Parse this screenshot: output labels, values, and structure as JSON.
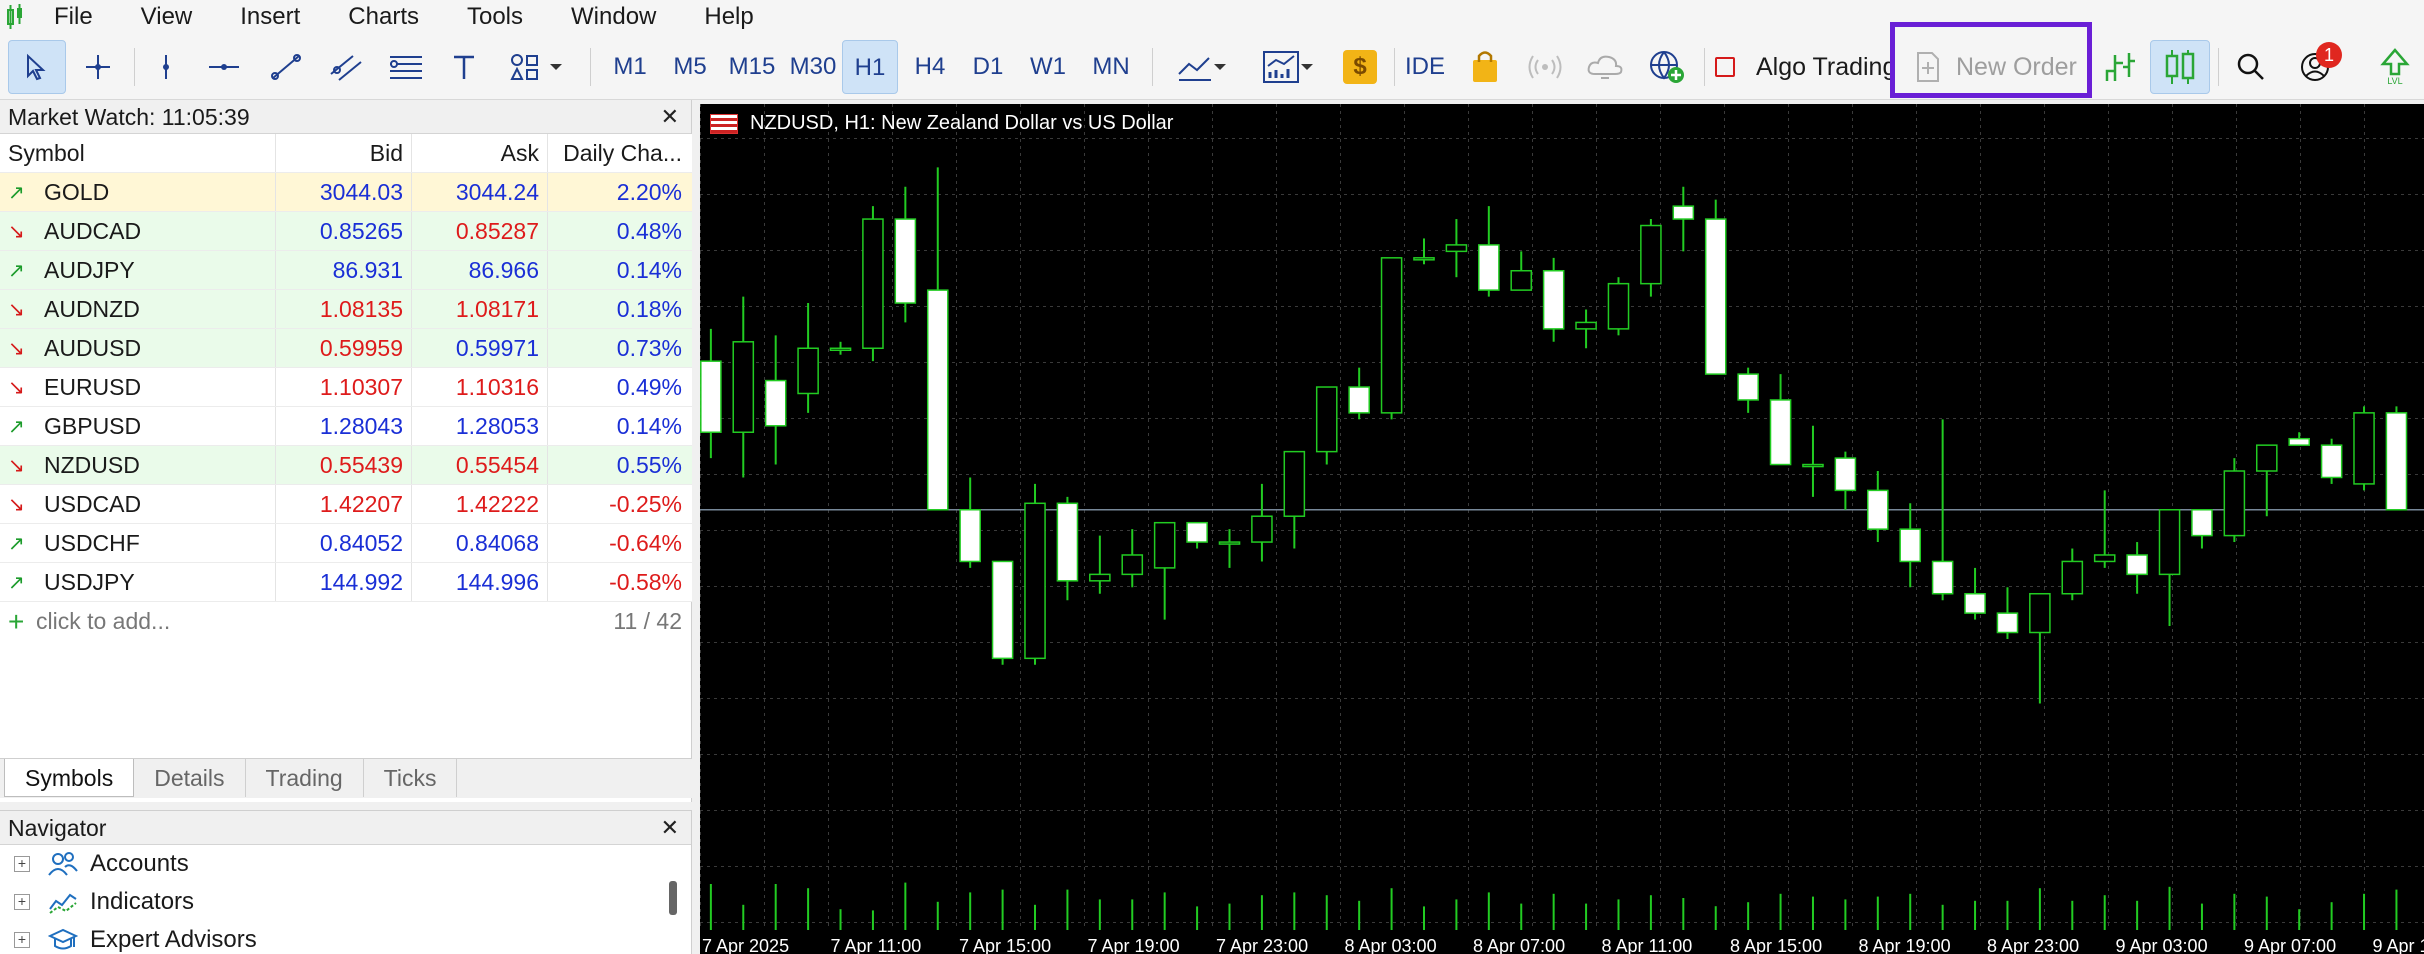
{
  "menu": [
    "File",
    "View",
    "Insert",
    "Charts",
    "Tools",
    "Window",
    "Help"
  ],
  "timeframes": [
    {
      "label": "M1",
      "active": false
    },
    {
      "label": "M5",
      "active": false
    },
    {
      "label": "M15",
      "active": false
    },
    {
      "label": "M30",
      "active": false
    },
    {
      "label": "H1",
      "active": true
    },
    {
      "label": "H4",
      "active": false
    },
    {
      "label": "D1",
      "active": false
    },
    {
      "label": "W1",
      "active": false
    },
    {
      "label": "MN",
      "active": false
    }
  ],
  "toolbar": {
    "ide_label": "IDE",
    "algo_trading_label": "Algo Trading",
    "new_order_label": "New Order",
    "notification_count": "1",
    "coin_symbol": "$"
  },
  "market_watch": {
    "title": "Market Watch: 11:05:39",
    "columns": [
      "Symbol",
      "Bid",
      "Ask",
      "Daily Cha..."
    ],
    "rows": [
      {
        "symbol": "GOLD",
        "dir": "up",
        "bid": "3044.03",
        "ask": "3044.24",
        "change": "2.20%",
        "bid_color": "blue",
        "ask_color": "blue",
        "change_color": "blue",
        "bg": "#fff7d6"
      },
      {
        "symbol": "AUDCAD",
        "dir": "down",
        "bid": "0.85265",
        "ask": "0.85287",
        "change": "0.48%",
        "bid_color": "blue",
        "ask_color": "red",
        "change_color": "blue",
        "bg": "#eafbea"
      },
      {
        "symbol": "AUDJPY",
        "dir": "up",
        "bid": "86.931",
        "ask": "86.966",
        "change": "0.14%",
        "bid_color": "blue",
        "ask_color": "blue",
        "change_color": "blue",
        "bg": "#eafbea"
      },
      {
        "symbol": "AUDNZD",
        "dir": "down",
        "bid": "1.08135",
        "ask": "1.08171",
        "change": "0.18%",
        "bid_color": "red",
        "ask_color": "red",
        "change_color": "blue",
        "bg": "#eafbea"
      },
      {
        "symbol": "AUDUSD",
        "dir": "down",
        "bid": "0.59959",
        "ask": "0.59971",
        "change": "0.73%",
        "bid_color": "red",
        "ask_color": "blue",
        "change_color": "blue",
        "bg": "#eafbea"
      },
      {
        "symbol": "EURUSD",
        "dir": "down",
        "bid": "1.10307",
        "ask": "1.10316",
        "change": "0.49%",
        "bid_color": "red",
        "ask_color": "red",
        "change_color": "blue",
        "bg": "#ffffff"
      },
      {
        "symbol": "GBPUSD",
        "dir": "up",
        "bid": "1.28043",
        "ask": "1.28053",
        "change": "0.14%",
        "bid_color": "blue",
        "ask_color": "blue",
        "change_color": "blue",
        "bg": "#ffffff"
      },
      {
        "symbol": "NZDUSD",
        "dir": "down",
        "bid": "0.55439",
        "ask": "0.55454",
        "change": "0.55%",
        "bid_color": "red",
        "ask_color": "red",
        "change_color": "blue",
        "bg": "#eafbea"
      },
      {
        "symbol": "USDCAD",
        "dir": "down",
        "bid": "1.42207",
        "ask": "1.42222",
        "change": "-0.25%",
        "bid_color": "red",
        "ask_color": "red",
        "change_color": "red",
        "bg": "#ffffff"
      },
      {
        "symbol": "USDCHF",
        "dir": "up",
        "bid": "0.84052",
        "ask": "0.84068",
        "change": "-0.64%",
        "bid_color": "blue",
        "ask_color": "blue",
        "change_color": "red",
        "bg": "#ffffff"
      },
      {
        "symbol": "USDJPY",
        "dir": "up",
        "bid": "144.992",
        "ask": "144.996",
        "change": "-0.58%",
        "bid_color": "blue",
        "ask_color": "blue",
        "change_color": "red",
        "bg": "#ffffff"
      }
    ],
    "add_placeholder": "click to add...",
    "count": "11 / 42",
    "tabs": [
      {
        "label": "Symbols",
        "active": true
      },
      {
        "label": "Details",
        "active": false
      },
      {
        "label": "Trading",
        "active": false
      },
      {
        "label": "Ticks",
        "active": false
      }
    ]
  },
  "navigator": {
    "title": "Navigator",
    "items": [
      {
        "label": "Accounts",
        "icon": "accounts-icon"
      },
      {
        "label": "Indicators",
        "icon": "indicators-icon"
      },
      {
        "label": "Expert Advisors",
        "icon": "expert-advisors-icon"
      }
    ]
  },
  "chart": {
    "title": "NZDUSD, H1:  New Zealand Dollar vs US Dollar",
    "x_labels": [
      "7 Apr 2025",
      "7 Apr 11:00",
      "7 Apr 15:00",
      "7 Apr 19:00",
      "7 Apr 23:00",
      "8 Apr 03:00",
      "8 Apr 07:00",
      "8 Apr 11:00",
      "8 Apr 15:00",
      "8 Apr 19:00",
      "8 Apr 23:00",
      "9 Apr 03:00",
      "9 Apr 07:00",
      "9 Apr 1"
    ]
  },
  "chart_data": {
    "type": "candlestick",
    "title": "NZDUSD, H1:  New Zealand Dollar vs US Dollar",
    "x_labels": [
      "7 Apr 2025",
      "7 Apr 11:00",
      "7 Apr 15:00",
      "7 Apr 19:00",
      "7 Apr 23:00",
      "8 Apr 03:00",
      "8 Apr 07:00",
      "8 Apr 11:00",
      "8 Apr 15:00",
      "8 Apr 19:00",
      "8 Apr 23:00",
      "9 Apr 03:00",
      "9 Apr 07:00",
      "9 Apr 1"
    ],
    "price_range": [
      0,
      100
    ],
    "candles": [
      {
        "o": 67,
        "h": 72,
        "l": 52,
        "c": 56
      },
      {
        "o": 56,
        "h": 77,
        "l": 49,
        "c": 70
      },
      {
        "o": 64,
        "h": 71,
        "l": 51,
        "c": 57
      },
      {
        "o": 62,
        "h": 76,
        "l": 59,
        "c": 69
      },
      {
        "o": 69,
        "h": 70,
        "l": 68,
        "c": 69
      },
      {
        "o": 69,
        "h": 91,
        "l": 67,
        "c": 89
      },
      {
        "o": 89,
        "h": 94,
        "l": 73,
        "c": 76
      },
      {
        "o": 78,
        "h": 97,
        "l": 44,
        "c": 44
      },
      {
        "o": 44,
        "h": 49,
        "l": 35,
        "c": 36
      },
      {
        "o": 36,
        "h": 36,
        "l": 20,
        "c": 21
      },
      {
        "o": 21,
        "h": 48,
        "l": 20,
        "c": 45
      },
      {
        "o": 45,
        "h": 46,
        "l": 30,
        "c": 33
      },
      {
        "o": 33,
        "h": 40,
        "l": 31,
        "c": 34
      },
      {
        "o": 34,
        "h": 41,
        "l": 32,
        "c": 37
      },
      {
        "o": 35,
        "h": 41,
        "l": 27,
        "c": 42
      },
      {
        "o": 42,
        "h": 42,
        "l": 38,
        "c": 39
      },
      {
        "o": 39,
        "h": 41,
        "l": 35,
        "c": 39
      },
      {
        "o": 39,
        "h": 48,
        "l": 36,
        "c": 43
      },
      {
        "o": 43,
        "h": 52,
        "l": 38,
        "c": 53
      },
      {
        "o": 53,
        "h": 63,
        "l": 51,
        "c": 63
      },
      {
        "o": 63,
        "h": 66,
        "l": 58,
        "c": 59
      },
      {
        "o": 59,
        "h": 75,
        "l": 58,
        "c": 83
      },
      {
        "o": 83,
        "h": 86,
        "l": 82,
        "c": 83
      },
      {
        "o": 84,
        "h": 89,
        "l": 80,
        "c": 85
      },
      {
        "o": 85,
        "h": 91,
        "l": 77,
        "c": 78
      },
      {
        "o": 78,
        "h": 84,
        "l": 78,
        "c": 81
      },
      {
        "o": 81,
        "h": 83,
        "l": 70,
        "c": 72
      },
      {
        "o": 72,
        "h": 75,
        "l": 69,
        "c": 73
      },
      {
        "o": 72,
        "h": 80,
        "l": 71,
        "c": 79
      },
      {
        "o": 79,
        "h": 89,
        "l": 77,
        "c": 88
      },
      {
        "o": 91,
        "h": 94,
        "l": 84,
        "c": 89
      },
      {
        "o": 89,
        "h": 92,
        "l": 65,
        "c": 65
      },
      {
        "o": 65,
        "h": 66,
        "l": 59,
        "c": 61
      },
      {
        "o": 61,
        "h": 65,
        "l": 52,
        "c": 51
      },
      {
        "o": 51,
        "h": 57,
        "l": 46,
        "c": 51
      },
      {
        "o": 52,
        "h": 53,
        "l": 44,
        "c": 47
      },
      {
        "o": 47,
        "h": 50,
        "l": 39,
        "c": 41
      },
      {
        "o": 41,
        "h": 45,
        "l": 32,
        "c": 36
      },
      {
        "o": 36,
        "h": 58,
        "l": 30,
        "c": 31
      },
      {
        "o": 31,
        "h": 35,
        "l": 27,
        "c": 28
      },
      {
        "o": 28,
        "h": 32,
        "l": 24,
        "c": 25
      },
      {
        "o": 25,
        "h": 31,
        "l": 14,
        "c": 31
      },
      {
        "o": 31,
        "h": 38,
        "l": 30,
        "c": 36
      },
      {
        "o": 36,
        "h": 47,
        "l": 35,
        "c": 37
      },
      {
        "o": 37,
        "h": 39,
        "l": 31,
        "c": 34
      },
      {
        "o": 34,
        "h": 44,
        "l": 26,
        "c": 44
      },
      {
        "o": 44,
        "h": 44,
        "l": 38,
        "c": 40
      },
      {
        "o": 40,
        "h": 52,
        "l": 39,
        "c": 50
      },
      {
        "o": 50,
        "h": 54,
        "l": 43,
        "c": 54
      },
      {
        "o": 55,
        "h": 56,
        "l": 54,
        "c": 54
      },
      {
        "o": 54,
        "h": 55,
        "l": 48,
        "c": 49
      },
      {
        "o": 48,
        "h": 60,
        "l": 47,
        "c": 59
      },
      {
        "o": 59,
        "h": 60,
        "l": 44,
        "c": 44
      }
    ],
    "colors": {
      "background": "#000000",
      "bull_body": "#000000",
      "bear_body": "#ffffff",
      "wick": "#22cc22",
      "grid": "#3a3a3a",
      "volume": "#22cc22"
    }
  }
}
